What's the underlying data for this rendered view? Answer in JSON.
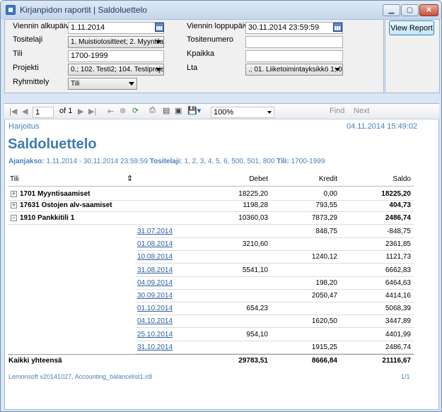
{
  "window": {
    "title": "Kirjanpidon raportit | Saldoluettelo"
  },
  "params": {
    "viennin_alkupaiva": {
      "label": "Viennin alkupäivä",
      "value": "1.11.2014"
    },
    "viennin_loppupaiva": {
      "label": "Viennin loppupäivä",
      "value": "30.11.2014 23:59:59"
    },
    "tositelaji": {
      "label": "Tositelaji",
      "value": "1. Muistiotositteet; 2. Myyntilask"
    },
    "tositenumero": {
      "label": "Tositenumero",
      "value": ""
    },
    "tili": {
      "label": "Tili",
      "value": "1700-1999"
    },
    "kpaikka": {
      "label": "Kpaikka",
      "value": ""
    },
    "projekti": {
      "label": "Projekti",
      "value": "0.; 102. Testi2; 104. Testiprojek"
    },
    "lta": {
      "label": "Lta",
      "value": ".; 01. Liiketoimintayksikkö 1; 02"
    },
    "ryhmittely": {
      "label": "Ryhmittely",
      "value": "Tili"
    },
    "view_report_label": "View Report"
  },
  "toolbar": {
    "page_value": "1",
    "of_label": "of 1",
    "zoom_value": "100%",
    "find_label": "Find",
    "next_label": "Next"
  },
  "report": {
    "company": "Harjoitus",
    "printed_at": "04.11.2014 15:49:02",
    "title": "Saldoluettelo",
    "criteria": {
      "ajanjakso_label": "Ajanjakso:",
      "ajanjakso_value": "1.11.2014 - 30.11.2014 23:59:59",
      "tositelaji_label": "Tositelaji:",
      "tositelaji_value": "1, 2, 3, 4, 5, 6, 500, 501, 800",
      "tili_label": "Tili:",
      "tili_value": "1700-1999"
    },
    "columns": {
      "tili": "Tili",
      "debet": "Debet",
      "kredit": "Kredit",
      "saldo": "Saldo"
    },
    "groups": [
      {
        "name": "1701 Myyntisaamiset",
        "debet": "18225,20",
        "kredit": "0,00",
        "saldo": "18225,20",
        "expander": "+"
      },
      {
        "name": "17631 Ostojen alv-saamiset",
        "debet": "1198,28",
        "kredit": "793,55",
        "saldo": "404,73",
        "expander": "+"
      },
      {
        "name": "1910 Pankkitili 1",
        "debet": "10360,03",
        "kredit": "7873,29",
        "saldo": "2486,74",
        "expander": "−"
      }
    ],
    "details": [
      {
        "date": "31.07.2014",
        "debet": "",
        "kredit": "848,75",
        "saldo": "-848,75"
      },
      {
        "date": "01.08.2014",
        "debet": "3210,60",
        "kredit": "",
        "saldo": "2361,85"
      },
      {
        "date": "10.08.2014",
        "debet": "",
        "kredit": "1240,12",
        "saldo": "1121,73"
      },
      {
        "date": "31.08.2014",
        "debet": "5541,10",
        "kredit": "",
        "saldo": "6662,83"
      },
      {
        "date": "04.09.2014",
        "debet": "",
        "kredit": "198,20",
        "saldo": "6464,63"
      },
      {
        "date": "30.09.2014",
        "debet": "",
        "kredit": "2050,47",
        "saldo": "4414,16"
      },
      {
        "date": "01.10.2014",
        "debet": "654,23",
        "kredit": "",
        "saldo": "5068,39"
      },
      {
        "date": "04.10.2014",
        "debet": "",
        "kredit": "1620,50",
        "saldo": "3447,89"
      },
      {
        "date": "25.10.2014",
        "debet": "954,10",
        "kredit": "",
        "saldo": "4401,99"
      },
      {
        "date": "31.10.2014",
        "debet": "",
        "kredit": "1915,25",
        "saldo": "2486,74"
      }
    ],
    "total": {
      "label": "Kaikki yhteensä",
      "debet": "29783,51",
      "kredit": "8666,84",
      "saldo": "21116,67"
    },
    "footer_left": "Lemonsoft v20141027, Accounting_balancelist1.rdl",
    "footer_right": "1/1"
  }
}
